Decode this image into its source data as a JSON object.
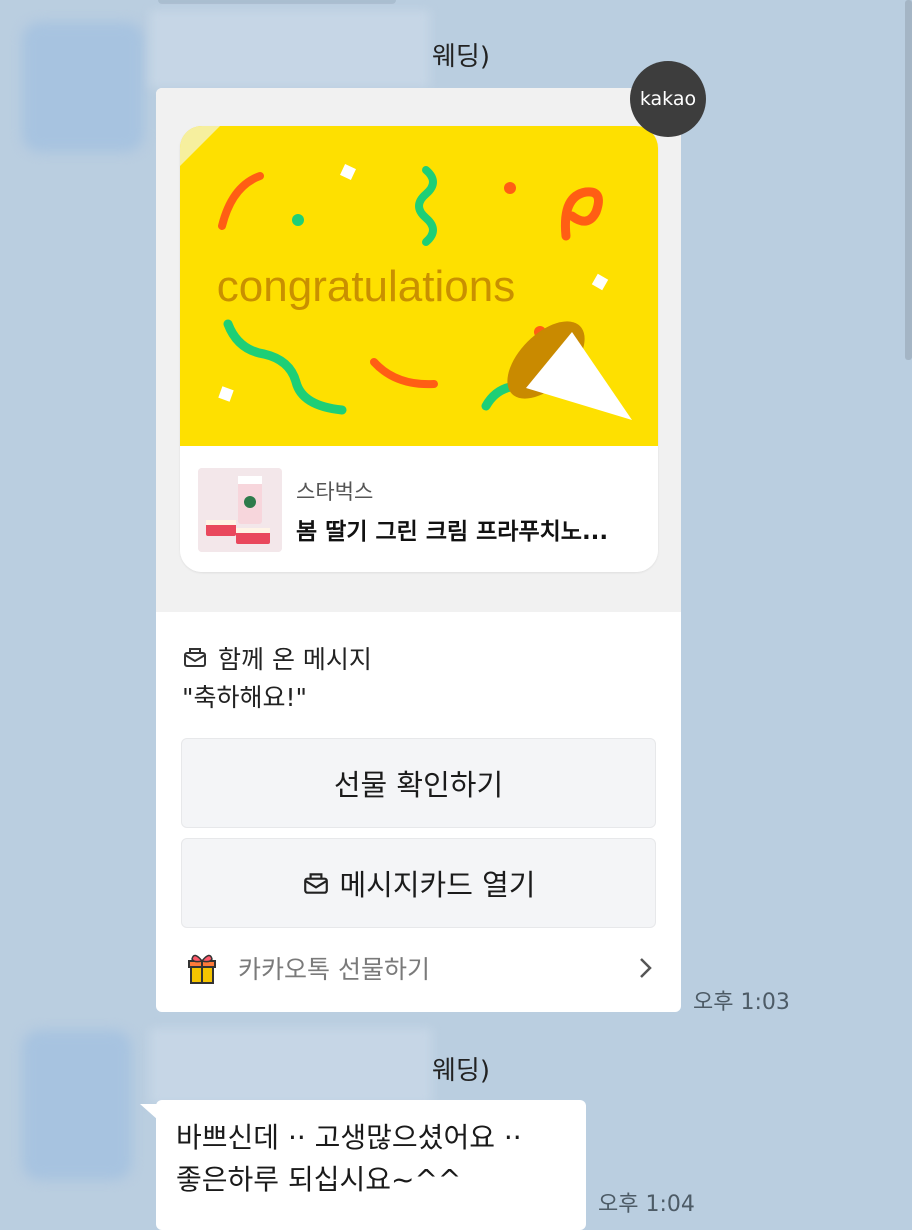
{
  "chat": {
    "messages": [
      {
        "sender_name_suffix": "웨딩)",
        "gift": {
          "badge": "kakao",
          "art_text": "congratulations",
          "brand": "스타벅스",
          "product": "봄 딸기 그린 크림 프라푸치노...",
          "message_title": "함께 온 메시지",
          "message_body": "\"축하해요!\"",
          "confirm_button": "선물 확인하기",
          "card_button": "메시지카드 열기",
          "footer_label": "카카오톡 선물하기"
        },
        "time": "오후 1:03"
      },
      {
        "sender_name_suffix": "웨딩)",
        "text_lines": [
          "바쁘신데 ·· 고생많으셨어요 ··",
          "좋은하루 되십시요~^^"
        ],
        "time": "오후 1:04"
      }
    ]
  },
  "colors": {
    "chat_background": "#bacee0",
    "gift_yellow": "#fee000",
    "art_text": "#c99000",
    "confetti_orange": "#ff5e14",
    "confetti_green": "#1ecf76"
  },
  "icons": {
    "message": "envelope-icon",
    "gift": "gift-box-icon",
    "chevron": "chevron-right-icon"
  }
}
